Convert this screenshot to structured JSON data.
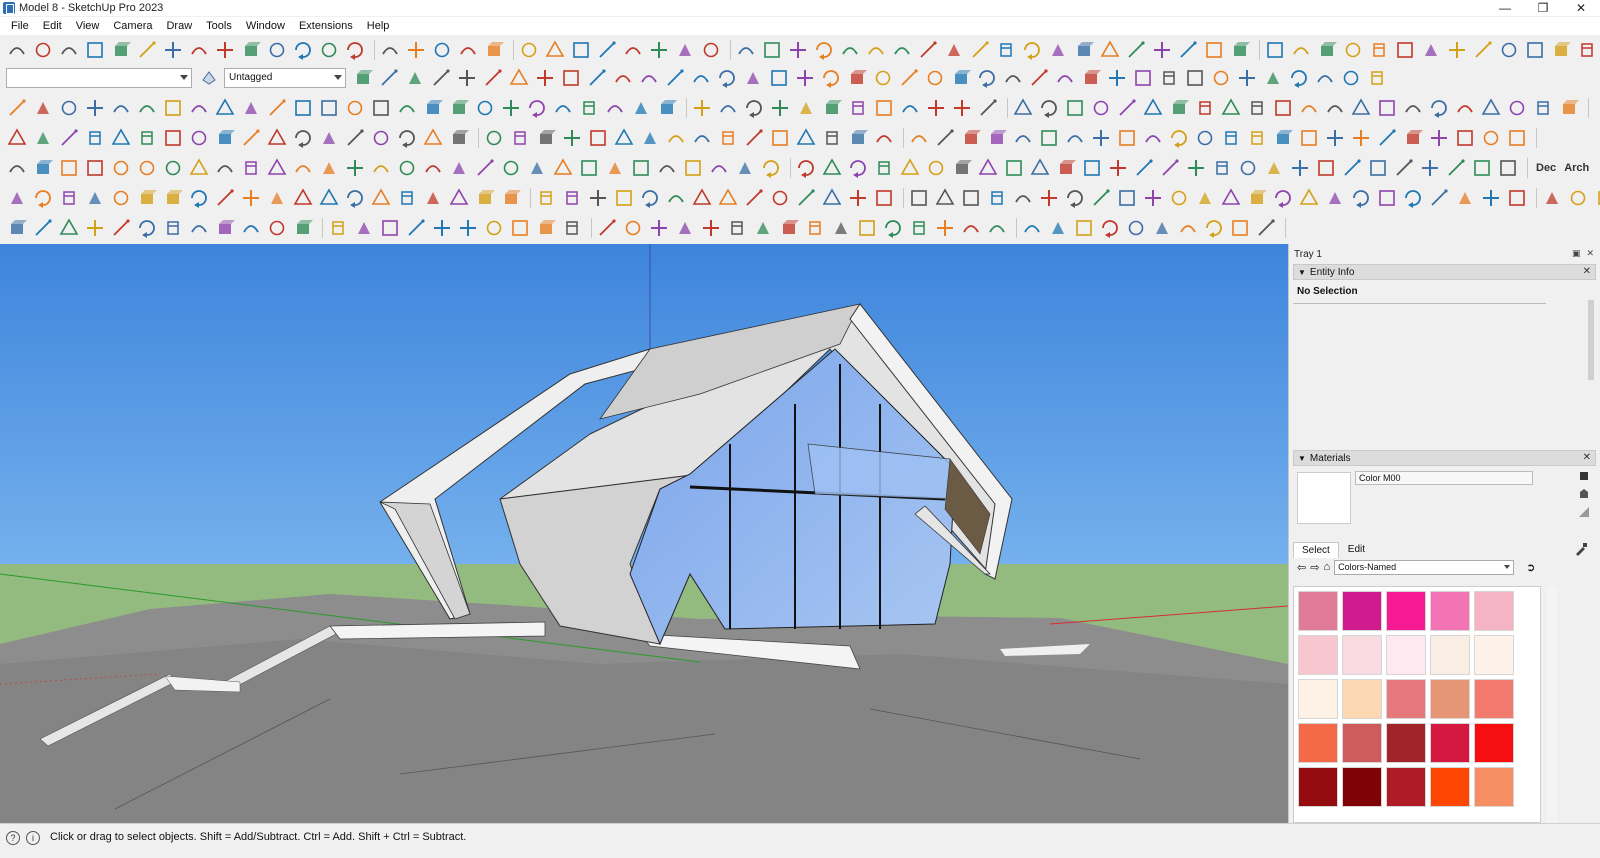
{
  "window": {
    "title": "Model 8 - SketchUp Pro 2023",
    "minimize": "—",
    "restore": "❐",
    "close": "✕"
  },
  "menu": [
    "File",
    "Edit",
    "View",
    "Camera",
    "Draw",
    "Tools",
    "Window",
    "Extensions",
    "Help"
  ],
  "toolbar": {
    "tag_combo_value": "Untagged",
    "style_combo_value": "",
    "text_buttons": [
      "Dec",
      "Arch"
    ]
  },
  "tray": {
    "title": "Tray 1",
    "entity_info": {
      "header": "Entity Info",
      "selection": "No Selection"
    },
    "materials": {
      "header": "Materials",
      "material_name": "Color M00",
      "tabs": [
        "Select",
        "Edit"
      ],
      "library": "Colors-Named",
      "swatches": [
        "#df7a98",
        "#cf1b8e",
        "#f51a93",
        "#f373b5",
        "#f5b4c6",
        "#f7c6cf",
        "#f8dbe0",
        "#fde9ef",
        "#faeee4",
        "#fcf2ea",
        "#fef1e6",
        "#fcd8b3",
        "#e6777a",
        "#e79675",
        "#f27a6f",
        "#f46a48",
        "#cf5c5c",
        "#a1242a",
        "#d5183f",
        "#f60e10",
        "#940c10",
        "#7e0206",
        "#b01c25",
        "#fe4603",
        "#f68d63"
      ]
    }
  },
  "status": {
    "text": "Click or drag to select objects. Shift = Add/Subtract. Ctrl = Add. Shift + Ctrl = Subtract."
  },
  "colors": {
    "sky": "#4a8fe0",
    "ground": "#93bb7f",
    "terrain": "#8a8a8a",
    "glass": "#8fb5ef"
  }
}
